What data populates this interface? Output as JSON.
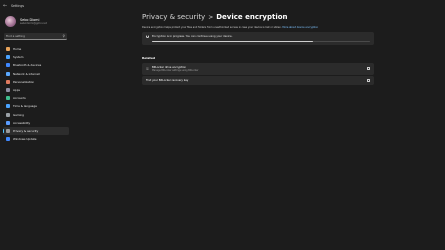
{
  "window": {
    "title": "Settings"
  },
  "profile": {
    "name": "Sebo Diomi",
    "email": "sebodiomi@gmx.net"
  },
  "search": {
    "placeholder": "Find a setting"
  },
  "nav": [
    {
      "label": "Home",
      "color": "#e8a35a"
    },
    {
      "label": "System",
      "color": "#4aa3ff"
    },
    {
      "label": "Bluetooth & devices",
      "color": "#3f88ff"
    },
    {
      "label": "Network & internet",
      "color": "#5aa9ff"
    },
    {
      "label": "Personalization",
      "color": "#e07a5f"
    },
    {
      "label": "Apps",
      "color": "#8e8ea3"
    },
    {
      "label": "Accounts",
      "color": "#3fbf8f"
    },
    {
      "label": "Time & language",
      "color": "#4aa3ff"
    },
    {
      "label": "Gaming",
      "color": "#9aa0a6"
    },
    {
      "label": "Accessibility",
      "color": "#5a9cff"
    },
    {
      "label": "Privacy & security",
      "color": "#9a9a9a",
      "active": true
    },
    {
      "label": "Windows Update",
      "color": "#3f88ff"
    }
  ],
  "breadcrumb": {
    "parent": "Privacy & security",
    "separator": ">",
    "current": "Device encryption"
  },
  "description": {
    "text": "Device encryption helps protect your files and folders from unauthorized access in case your device is lost or stolen.",
    "link": "More about device encryption"
  },
  "status": {
    "message": "Encryption is in progress. You can continue using your device.",
    "progress_fraction": 0.74
  },
  "related": {
    "title": "Related",
    "items": [
      {
        "title": "BitLocker drive encryption",
        "subtitle": "Manage BitLocker settings using BitLocker",
        "icon": "key-icon"
      },
      {
        "title": "Find your BitLocker recovery key"
      }
    ]
  },
  "colors": {
    "accent": "#4cc2ff",
    "background": "#1c1c1c",
    "card": "#2b2b2b"
  }
}
